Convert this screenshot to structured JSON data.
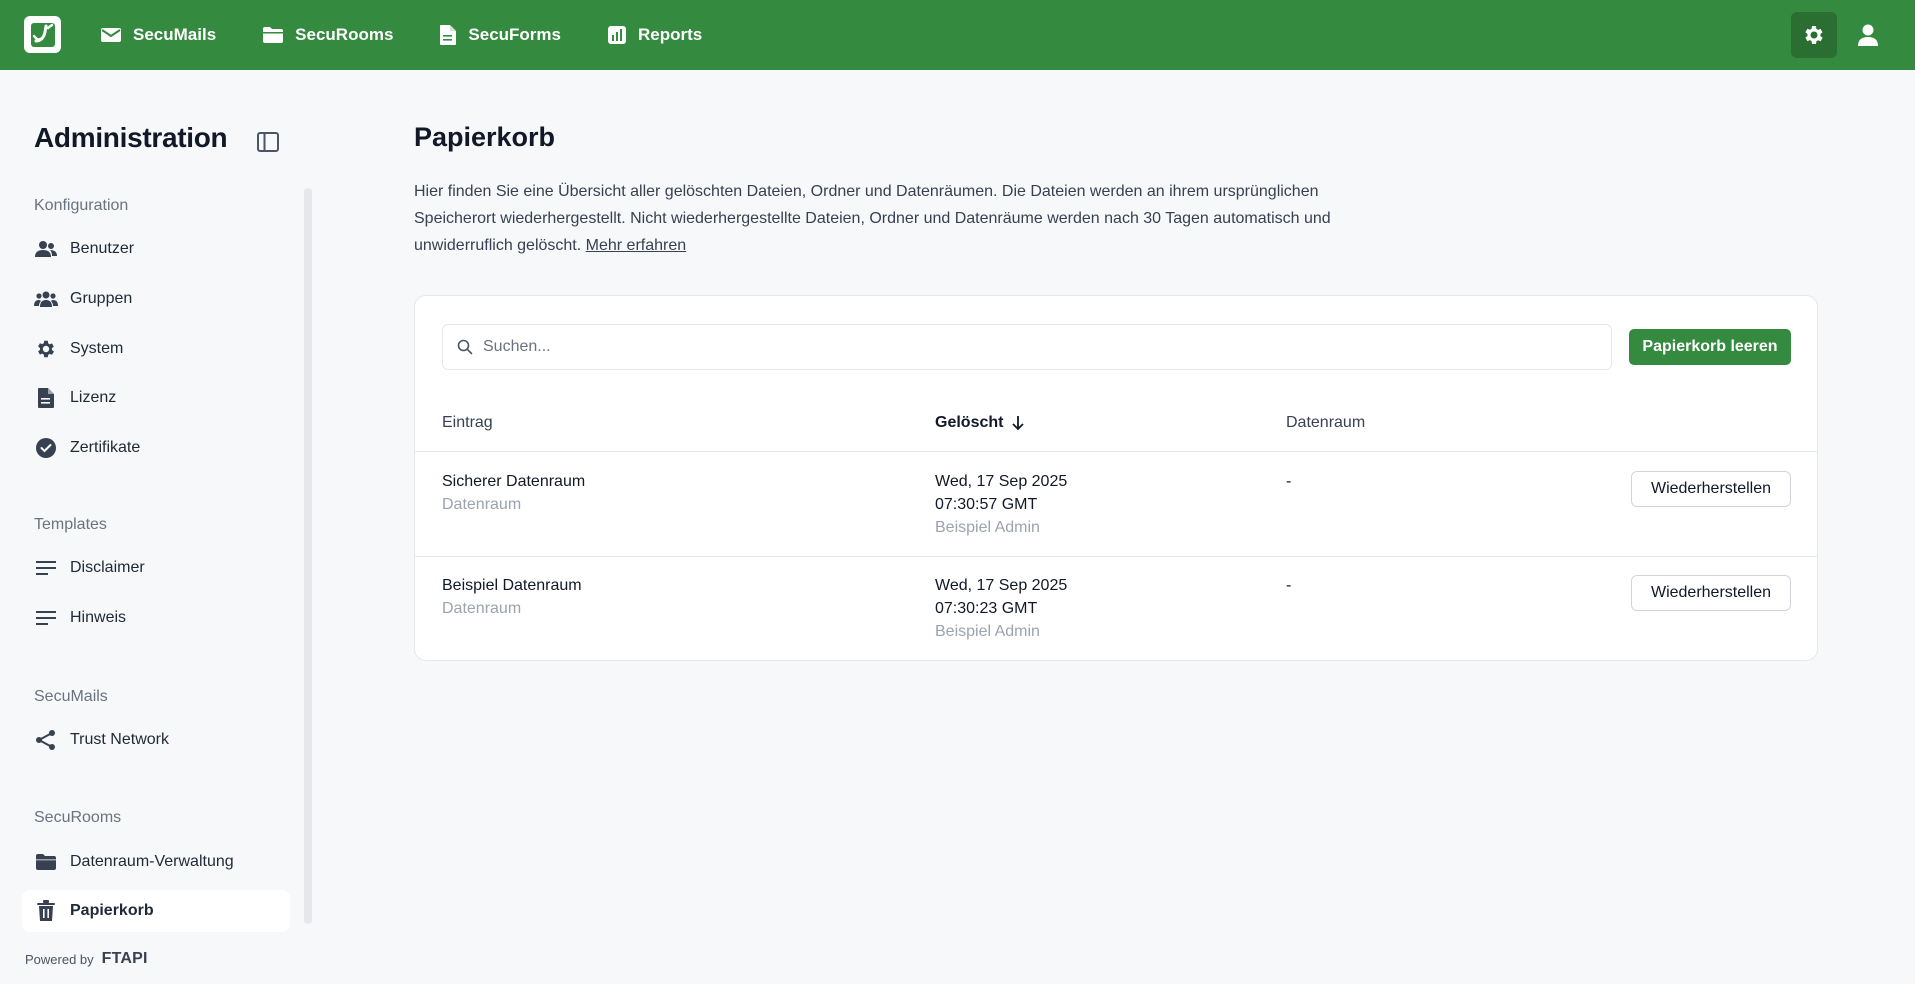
{
  "header": {
    "nav": [
      {
        "label": "SecuMails",
        "icon": "mail-icon"
      },
      {
        "label": "SecuRooms",
        "icon": "folder-icon"
      },
      {
        "label": "SecuForms",
        "icon": "form-icon"
      },
      {
        "label": "Reports",
        "icon": "chart-icon"
      }
    ],
    "brand_color": "#348a3f"
  },
  "sidebar": {
    "title": "Administration",
    "sections": [
      {
        "label": "Konfiguration",
        "items": [
          {
            "label": "Benutzer",
            "icon": "user-icon"
          },
          {
            "label": "Gruppen",
            "icon": "users-icon"
          },
          {
            "label": "System",
            "icon": "gear-icon"
          },
          {
            "label": "Lizenz",
            "icon": "document-icon"
          },
          {
            "label": "Zertifikate",
            "icon": "check-badge-icon"
          }
        ]
      },
      {
        "label": "Templates",
        "items": [
          {
            "label": "Disclaimer",
            "icon": "text-lines-icon"
          },
          {
            "label": "Hinweis",
            "icon": "text-lines-icon"
          }
        ]
      },
      {
        "label": "SecuMails",
        "items": [
          {
            "label": "Trust Network",
            "icon": "share-icon"
          }
        ]
      },
      {
        "label": "SecuRooms",
        "items": [
          {
            "label": "Datenraum-Verwaltung",
            "icon": "folder-icon"
          },
          {
            "label": "Papierkorb",
            "icon": "trash-icon",
            "active": true
          }
        ]
      }
    ],
    "powered_by": "Powered by",
    "powered_brand": "FTAPI"
  },
  "main": {
    "title": "Papierkorb",
    "description": "Hier finden Sie eine Übersicht aller gelöschten Dateien, Ordner und Datenräumen. Die Dateien werden an ihrem ursprünglichen Speicherort wiederhergestellt. Nicht wiederhergestellte Dateien, Ordner und Datenräume werden nach 30 Tagen automatisch und unwiderruflich gelöscht.",
    "learn_more": "Mehr erfahren",
    "search_placeholder": "Suchen...",
    "empty_trash_label": "Papierkorb leeren",
    "columns": {
      "entry": "Eintrag",
      "deleted": "Gelöscht",
      "room": "Datenraum"
    },
    "rows": [
      {
        "name": "Sicherer Datenraum",
        "type": "Datenraum",
        "date": "Wed, 17 Sep 2025",
        "time": "07:30:57 GMT",
        "by": "Beispiel Admin",
        "room": "-",
        "action": "Wiederherstellen"
      },
      {
        "name": "Beispiel Datenraum",
        "type": "Datenraum",
        "date": "Wed, 17 Sep 2025",
        "time": "07:30:23 GMT",
        "by": "Beispiel Admin",
        "room": "-",
        "action": "Wiederherstellen"
      }
    ]
  }
}
